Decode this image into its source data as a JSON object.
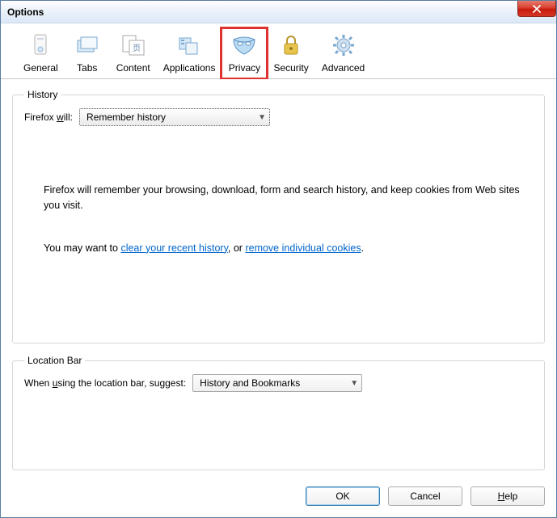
{
  "window": {
    "title": "Options"
  },
  "toolbar": {
    "items": [
      {
        "label": "General"
      },
      {
        "label": "Tabs"
      },
      {
        "label": "Content"
      },
      {
        "label": "Applications"
      },
      {
        "label": "Privacy"
      },
      {
        "label": "Security"
      },
      {
        "label": "Advanced"
      }
    ]
  },
  "history": {
    "legend": "History",
    "label_pre": "Firefox ",
    "label_key": "w",
    "label_post": "ill:",
    "select_value": "Remember history",
    "desc1": "Firefox will remember your browsing, download, form and search history, and keep cookies from Web sites you visit.",
    "desc2_pre": "You may want to ",
    "link1": "clear your recent history",
    "desc2_mid": ", or ",
    "link2": "remove individual cookies",
    "desc2_post": "."
  },
  "location": {
    "legend": "Location Bar",
    "label_pre": "When ",
    "label_key": "u",
    "label_post": "sing the location bar, suggest:",
    "select_value": "History and Bookmarks"
  },
  "buttons": {
    "ok": "OK",
    "cancel": "Cancel",
    "help_key": "H",
    "help_post": "elp"
  }
}
